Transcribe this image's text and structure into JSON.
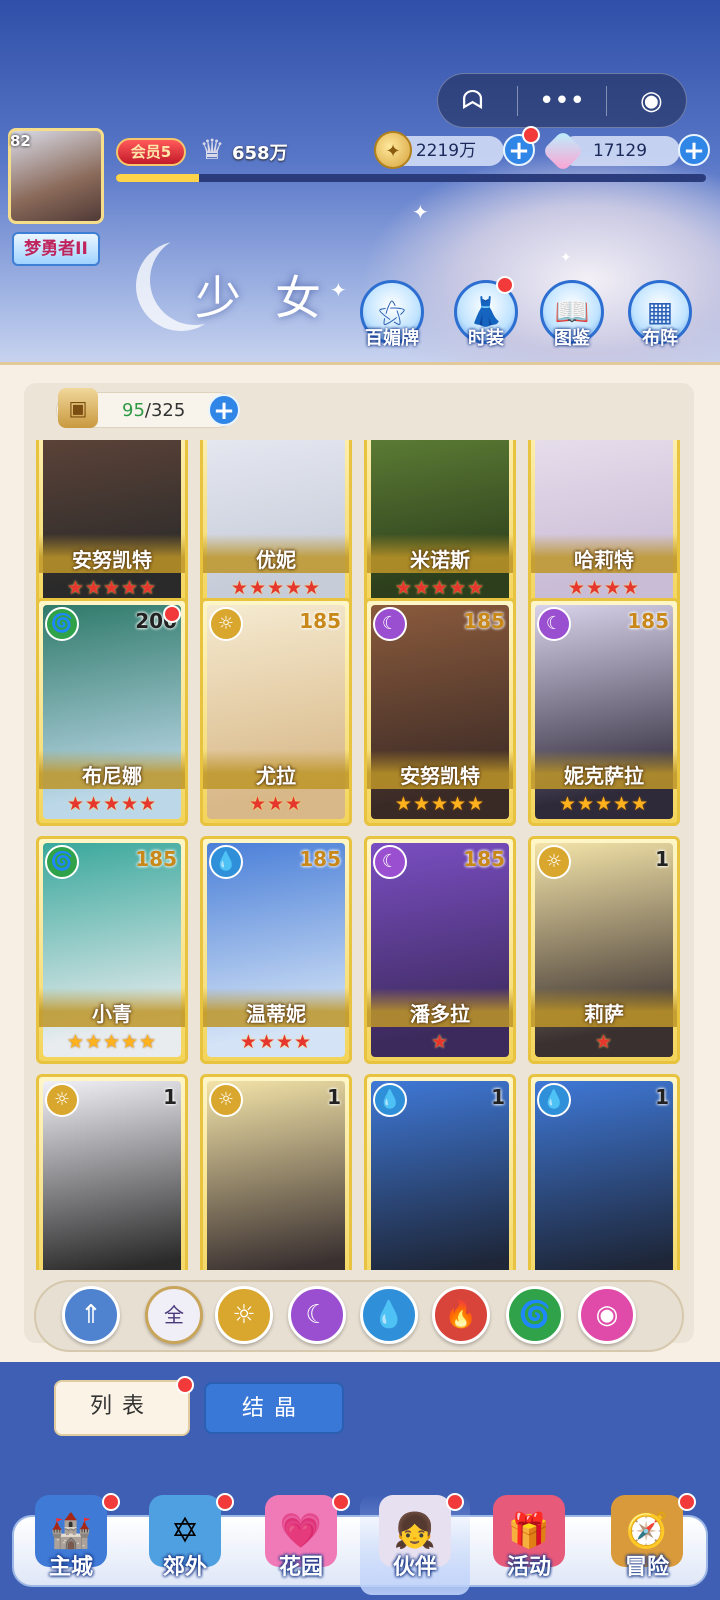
{
  "top_bar": {
    "level": "82",
    "title": "梦勇者II",
    "vip": "会员5",
    "power": "658万",
    "gold": "2219万",
    "gems": "17129",
    "exp_progress": 0.14
  },
  "mini_program": {
    "ghost_icon": "ghost-icon",
    "more_icon": "more-icon",
    "close_icon": "target-icon"
  },
  "section": {
    "title": "少女",
    "buttons": [
      {
        "label": "百媚牌",
        "icon": "card-icon"
      },
      {
        "label": "时装",
        "icon": "dress-icon"
      },
      {
        "label": "图鉴",
        "icon": "book-icon"
      },
      {
        "label": "布阵",
        "icon": "grid-icon"
      }
    ]
  },
  "capacity": {
    "current": "95",
    "total": "/325"
  },
  "cards": [
    {
      "name": "安努凯特",
      "stars": 5,
      "star_color": "red",
      "level": "",
      "element": "",
      "colors": [
        "#6b4a3c",
        "#2a2a2a"
      ]
    },
    {
      "name": "优妮",
      "stars": 5,
      "star_color": "red",
      "level": "",
      "element": "",
      "colors": [
        "#eef0f8",
        "#c7ccd9"
      ]
    },
    {
      "name": "米诺斯",
      "stars": 5,
      "star_color": "red",
      "level": "",
      "element": "",
      "colors": [
        "#6b8f3c",
        "#2c3e1c"
      ]
    },
    {
      "name": "哈莉特",
      "stars": 4,
      "star_color": "red",
      "level": "",
      "element": "",
      "colors": [
        "#f0e8f2",
        "#c9bcd6"
      ]
    },
    {
      "name": "布尼娜",
      "stars": 5,
      "star_color": "red",
      "level": "200",
      "element": "wind",
      "colors": [
        "#2f7a6a",
        "#bcd8e8"
      ]
    },
    {
      "name": "尤拉",
      "stars": 3,
      "star_color": "red",
      "level": "185",
      "element": "light",
      "colors": [
        "#f5ead0",
        "#d8b888"
      ]
    },
    {
      "name": "安努凯特",
      "stars": 5,
      "star_color": "gold",
      "level": "185",
      "element": "dark",
      "colors": [
        "#8a5a3c",
        "#3a2a26"
      ]
    },
    {
      "name": "妮克萨拉",
      "stars": 5,
      "star_color": "gold",
      "level": "185",
      "element": "dark",
      "colors": [
        "#d8d2ea",
        "#2e2a3a"
      ]
    },
    {
      "name": "小青",
      "stars": 5,
      "star_color": "gold",
      "level": "185",
      "element": "wind",
      "colors": [
        "#3aa89c",
        "#e8ecef"
      ]
    },
    {
      "name": "温蒂妮",
      "stars": 4,
      "star_color": "red",
      "level": "185",
      "element": "water",
      "colors": [
        "#4a7fd8",
        "#d4e3f6"
      ]
    },
    {
      "name": "潘多拉",
      "stars": 1,
      "star_color": "red",
      "level": "185",
      "element": "dark",
      "colors": [
        "#7a4ec2",
        "#3c2a5c"
      ]
    },
    {
      "name": "莉萨",
      "stars": 1,
      "star_color": "red",
      "level": "1",
      "element": "light",
      "colors": [
        "#f3e3a8",
        "#3a3030"
      ]
    },
    {
      "name": "",
      "stars": 0,
      "star_color": "red",
      "level": "1",
      "element": "light",
      "colors": [
        "#f0f0f6",
        "#2a2a2a"
      ]
    },
    {
      "name": "",
      "stars": 0,
      "star_color": "red",
      "level": "1",
      "element": "light",
      "colors": [
        "#f3e3a8",
        "#3a3030"
      ]
    },
    {
      "name": "",
      "stars": 0,
      "star_color": "red",
      "level": "1",
      "element": "water",
      "colors": [
        "#3f78d6",
        "#1e2638"
      ]
    },
    {
      "name": "",
      "stars": 0,
      "star_color": "red",
      "level": "1",
      "element": "water",
      "colors": [
        "#3f78d6",
        "#1e2638"
      ]
    }
  ],
  "filters": [
    {
      "id": "sort",
      "label": "⇑",
      "color": "#4f82cf"
    },
    {
      "id": "all",
      "label": "全",
      "color": "#f0eef6"
    },
    {
      "id": "light",
      "label": "☼",
      "color": "#d9a72e"
    },
    {
      "id": "dark",
      "label": "☾",
      "color": "#9a4fd0"
    },
    {
      "id": "water",
      "label": "💧",
      "color": "#2f8fd8"
    },
    {
      "id": "fire",
      "label": "🔥",
      "color": "#d8443a"
    },
    {
      "id": "wind",
      "label": "🌀",
      "color": "#2fa24a"
    },
    {
      "id": "heart",
      "label": "◉",
      "color": "#e04aa8"
    }
  ],
  "element_colors": {
    "wind": "#2fa24a",
    "light": "#d9a72e",
    "dark": "#9a4fd0",
    "water": "#2f8fd8"
  },
  "element_glyphs": {
    "wind": "🌀",
    "light": "☼",
    "dark": "☾",
    "water": "💧"
  },
  "tabs": {
    "list": "列表",
    "crystal": "结晶"
  },
  "nav": [
    {
      "label": "主城",
      "icon": "castle-icon",
      "glyph": "🏰"
    },
    {
      "label": "郊外",
      "icon": "portal-icon",
      "glyph": "✡"
    },
    {
      "label": "花园",
      "icon": "heart-icon",
      "glyph": "💗"
    },
    {
      "label": "伙伴",
      "icon": "girl-icon",
      "glyph": "👧"
    },
    {
      "label": "活动",
      "icon": "gift-icon",
      "glyph": "🎁"
    },
    {
      "label": "冒险",
      "icon": "compass-icon",
      "glyph": "🧭"
    }
  ]
}
